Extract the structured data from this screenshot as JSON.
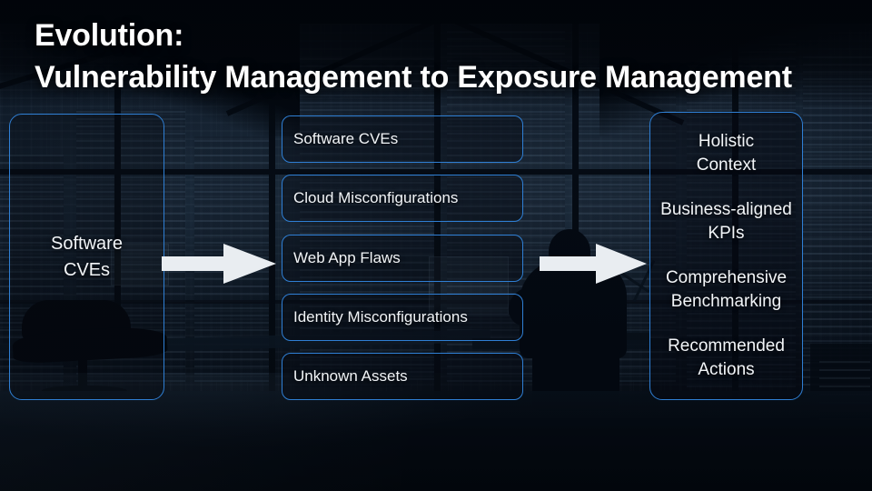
{
  "slide": {
    "title": "Evolution:\nVulnerability Management to Exposure Management",
    "accent_color": "#2f7fd4",
    "text_color": "#f2f5f8",
    "background_color": "#050a12",
    "arrow_color": "#e9edf1"
  },
  "left_panel": {
    "label": "Software\nCVEs"
  },
  "middle_column": {
    "items": [
      {
        "label": "Software CVEs"
      },
      {
        "label": "Cloud Misconfigurations"
      },
      {
        "label": "Web App Flaws"
      },
      {
        "label": "Identity Misconfigurations"
      },
      {
        "label": "Unknown Assets"
      }
    ]
  },
  "right_panel": {
    "items": [
      {
        "label": "Holistic\nContext"
      },
      {
        "label": "Business-aligned\nKPIs"
      },
      {
        "label": "Comprehensive\nBenchmarking"
      },
      {
        "label": "Recommended\nActions"
      }
    ]
  },
  "arrows": [
    {
      "name": "arrow-left-to-middle",
      "direction": "right"
    },
    {
      "name": "arrow-middle-to-right",
      "direction": "right"
    }
  ]
}
